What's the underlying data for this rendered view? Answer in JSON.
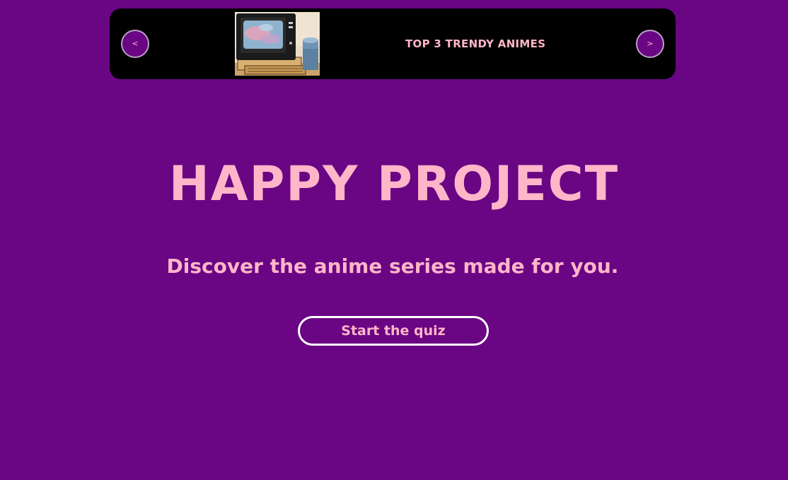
{
  "carousel": {
    "prev_label": "<",
    "next_label": ">",
    "title": "TOP 3 TRENDY ANIMES",
    "image_icon": "retro-computer-image"
  },
  "hero": {
    "title": "HAPPY PROJECT",
    "subtitle": "Discover the anime series made for you."
  },
  "cta": {
    "label": "Start the quiz"
  },
  "colors": {
    "background": "#6a0584",
    "accent_pink": "#ffb6c9",
    "carousel_bg": "#000000",
    "button_border": "#ffffff"
  }
}
